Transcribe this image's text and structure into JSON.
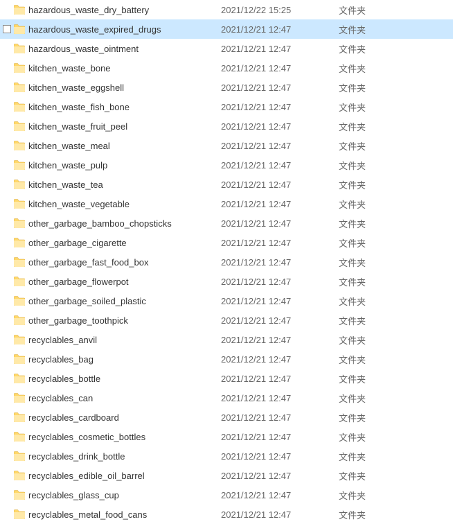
{
  "files": [
    {
      "name": "hazardous_waste_dry_battery",
      "date": "2021/12/22 15:25",
      "type": "文件夹",
      "selected": false
    },
    {
      "name": "hazardous_waste_expired_drugs",
      "date": "2021/12/21 12:47",
      "type": "文件夹",
      "selected": true
    },
    {
      "name": "hazardous_waste_ointment",
      "date": "2021/12/21 12:47",
      "type": "文件夹",
      "selected": false
    },
    {
      "name": "kitchen_waste_bone",
      "date": "2021/12/21 12:47",
      "type": "文件夹",
      "selected": false
    },
    {
      "name": "kitchen_waste_eggshell",
      "date": "2021/12/21 12:47",
      "type": "文件夹",
      "selected": false
    },
    {
      "name": "kitchen_waste_fish_bone",
      "date": "2021/12/21 12:47",
      "type": "文件夹",
      "selected": false
    },
    {
      "name": "kitchen_waste_fruit_peel",
      "date": "2021/12/21 12:47",
      "type": "文件夹",
      "selected": false
    },
    {
      "name": "kitchen_waste_meal",
      "date": "2021/12/21 12:47",
      "type": "文件夹",
      "selected": false
    },
    {
      "name": "kitchen_waste_pulp",
      "date": "2021/12/21 12:47",
      "type": "文件夹",
      "selected": false
    },
    {
      "name": "kitchen_waste_tea",
      "date": "2021/12/21 12:47",
      "type": "文件夹",
      "selected": false
    },
    {
      "name": "kitchen_waste_vegetable",
      "date": "2021/12/21 12:47",
      "type": "文件夹",
      "selected": false
    },
    {
      "name": "other_garbage_bamboo_chopsticks",
      "date": "2021/12/21 12:47",
      "type": "文件夹",
      "selected": false
    },
    {
      "name": "other_garbage_cigarette",
      "date": "2021/12/21 12:47",
      "type": "文件夹",
      "selected": false
    },
    {
      "name": "other_garbage_fast_food_box",
      "date": "2021/12/21 12:47",
      "type": "文件夹",
      "selected": false
    },
    {
      "name": "other_garbage_flowerpot",
      "date": "2021/12/21 12:47",
      "type": "文件夹",
      "selected": false
    },
    {
      "name": "other_garbage_soiled_plastic",
      "date": "2021/12/21 12:47",
      "type": "文件夹",
      "selected": false
    },
    {
      "name": "other_garbage_toothpick",
      "date": "2021/12/21 12:47",
      "type": "文件夹",
      "selected": false
    },
    {
      "name": "recyclables_anvil",
      "date": "2021/12/21 12:47",
      "type": "文件夹",
      "selected": false
    },
    {
      "name": "recyclables_bag",
      "date": "2021/12/21 12:47",
      "type": "文件夹",
      "selected": false
    },
    {
      "name": "recyclables_bottle",
      "date": "2021/12/21 12:47",
      "type": "文件夹",
      "selected": false
    },
    {
      "name": "recyclables_can",
      "date": "2021/12/21 12:47",
      "type": "文件夹",
      "selected": false
    },
    {
      "name": "recyclables_cardboard",
      "date": "2021/12/21 12:47",
      "type": "文件夹",
      "selected": false
    },
    {
      "name": "recyclables_cosmetic_bottles",
      "date": "2021/12/21 12:47",
      "type": "文件夹",
      "selected": false
    },
    {
      "name": "recyclables_drink_bottle",
      "date": "2021/12/21 12:47",
      "type": "文件夹",
      "selected": false
    },
    {
      "name": "recyclables_edible_oil_barrel",
      "date": "2021/12/21 12:47",
      "type": "文件夹",
      "selected": false
    },
    {
      "name": "recyclables_glass_cup",
      "date": "2021/12/21 12:47",
      "type": "文件夹",
      "selected": false
    },
    {
      "name": "recyclables_metal_food_cans",
      "date": "2021/12/21 12:47",
      "type": "文件夹",
      "selected": false
    }
  ]
}
